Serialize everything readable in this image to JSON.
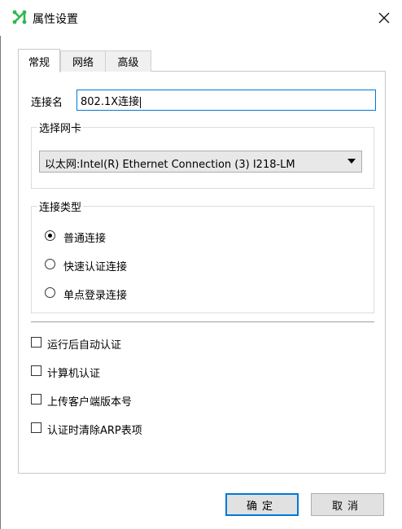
{
  "window": {
    "title": "属性设置"
  },
  "tabs": [
    {
      "label": "常规",
      "active": true
    },
    {
      "label": "网络",
      "active": false
    },
    {
      "label": "高级",
      "active": false
    }
  ],
  "connection_name": {
    "label": "连接名",
    "value": "802.1X连接"
  },
  "nic_group": {
    "title": "选择网卡",
    "selected": "以太网:Intel(R) Ethernet Connection (3) I218-LM"
  },
  "conn_type_group": {
    "title": "连接类型",
    "options": [
      {
        "label": "普通连接",
        "selected": true
      },
      {
        "label": "快速认证连接",
        "selected": false
      },
      {
        "label": "单点登录连接",
        "selected": false
      }
    ]
  },
  "checkboxes": [
    {
      "label": "运行后自动认证",
      "checked": false
    },
    {
      "label": "计算机认证",
      "checked": false
    },
    {
      "label": "上传客户端版本号",
      "checked": false
    },
    {
      "label": "认证时清除ARP表项",
      "checked": false
    }
  ],
  "buttons": {
    "ok": "确定",
    "cancel": "取消"
  },
  "colors": {
    "accent": "#0078d7",
    "icon_green": "#2db84d"
  },
  "icons": {
    "app": "network-nodes-icon",
    "close": "close-icon",
    "dropdown": "triangle-down-icon"
  }
}
